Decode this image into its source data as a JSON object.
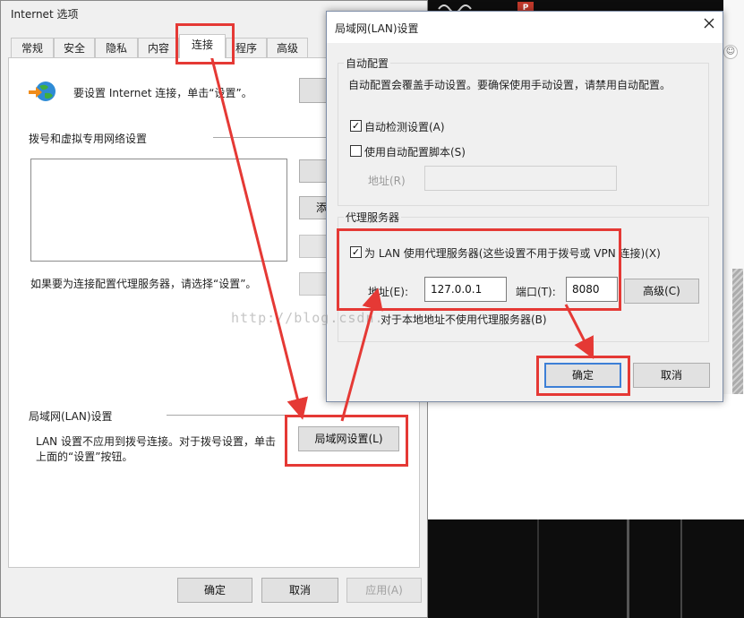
{
  "internet_options": {
    "title": "Internet 选项",
    "tabs": [
      "常规",
      "安全",
      "隐私",
      "内容",
      "连接",
      "程序",
      "高级"
    ],
    "active_tab": "连接",
    "setup_text": "要设置 Internet 连接，单击“设置”。",
    "dialup_section_label": "拨号和虚拟专用网络设置",
    "add_button_partial": "添",
    "proxy_hint": "如果要为连接配置代理服务器，请选择“设置”。",
    "lan_section_label": "局域网(LAN)设置",
    "lan_desc_line1": "LAN 设置不应用到拨号连接。对于拨号设置，单击",
    "lan_desc_line2": "上面的“设置”按钮。",
    "lan_settings_button": "局域网设置(L)",
    "ok_button": "确定",
    "cancel_button": "取消",
    "apply_button": "应用(A)"
  },
  "lan_dialog": {
    "title": "局域网(LAN)设置",
    "auto_config_group": "自动配置",
    "auto_config_desc": "自动配置会覆盖手动设置。要确保使用手动设置，请禁用自动配置。",
    "auto_detect_label": "自动检测设置(A)",
    "auto_detect_checked": true,
    "use_script_label": "使用自动配置脚本(S)",
    "use_script_checked": false,
    "script_address_label": "地址(R)",
    "script_address_value": "",
    "proxy_group": "代理服务器",
    "use_proxy_label": "为 LAN 使用代理服务器(这些设置不用于拨号或 VPN 连接)(X)",
    "use_proxy_checked": true,
    "address_label": "地址(E):",
    "address_value": "127.0.0.1",
    "port_label": "端口(T):",
    "port_value": "8080",
    "advanced_button": "高级(C)",
    "bypass_label": "对于本地地址不使用代理服务器(B)",
    "ok_button": "确定",
    "cancel_button": "取消"
  },
  "watermark": "http://blog.csdn.",
  "colors": {
    "annotation_red": "#e53935",
    "focus_blue": "#3c7fd6"
  }
}
